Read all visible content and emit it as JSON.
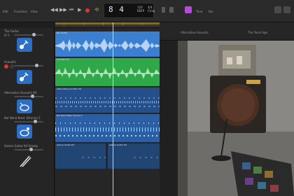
{
  "toolbar": {
    "left_items": [
      "Edit",
      "Functions",
      "View"
    ],
    "lcd": {
      "position": "8 4",
      "tempo": "120",
      "key_label": "KEEP",
      "tempo_label": "4/4",
      "key": "Cmaj"
    },
    "right_items": [
      "Tune",
      "Bar"
    ],
    "accent": "#b54bd6"
  },
  "right_header": {
    "label": "Alternative Acoustic",
    "sub_label": "The Tonal Age"
  },
  "tracks": [
    {
      "name": "The Guitar",
      "color": "#3a7fd0"
    },
    {
      "name": "Acoustic",
      "color": "#2fa84a"
    },
    {
      "name": "Alternative Acoustic Kit",
      "color": "#2a6bb8"
    },
    {
      "name": "Bar Band Basic (Drums) 2",
      "color": "#2a6bb8"
    },
    {
      "name": "Galore Guitar Kit Smoky",
      "color": "#2a6bb8"
    }
  ],
  "regions": [
    {
      "label": "Bar Guitar"
    },
    {
      "label": "Acoustic #1"
    },
    {
      "label": "Alternative Acoustic Kit"
    },
    {
      "label": "Bar Band Basic Drums 2"
    },
    {
      "label": "Galore Guitar Kit"
    },
    {
      "label": "Galore Guitar Kit"
    }
  ],
  "colors": {
    "audio_blue": "#3a7fd0",
    "audio_green": "#2fa84a",
    "drummer_blue": "#244f8a",
    "record_red": "#d8382f"
  }
}
